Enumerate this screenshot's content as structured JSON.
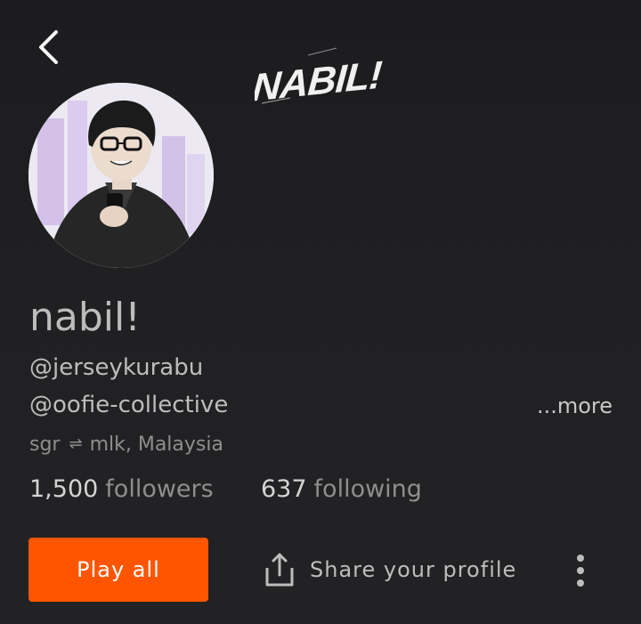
{
  "header": {
    "banner_text": "NABIL!"
  },
  "profile": {
    "display_name": "nabil!",
    "handles": [
      "@jerseykurabu",
      "@oofie-collective"
    ],
    "more_label": "...more",
    "location": {
      "from": "sgr",
      "separator": "⇌",
      "to": "mlk, Malaysia"
    }
  },
  "stats": {
    "followers": {
      "count": "1,500",
      "label": "followers"
    },
    "following": {
      "count": "637",
      "label": "following"
    }
  },
  "actions": {
    "play_all_label": "Play all",
    "share_label": "Share your profile"
  },
  "icons": {
    "back": "chevron-left-icon",
    "share": "share-icon",
    "overflow": "more-vertical-icon"
  },
  "colors": {
    "accent": "#ff5500",
    "background": "#1f1f21"
  }
}
